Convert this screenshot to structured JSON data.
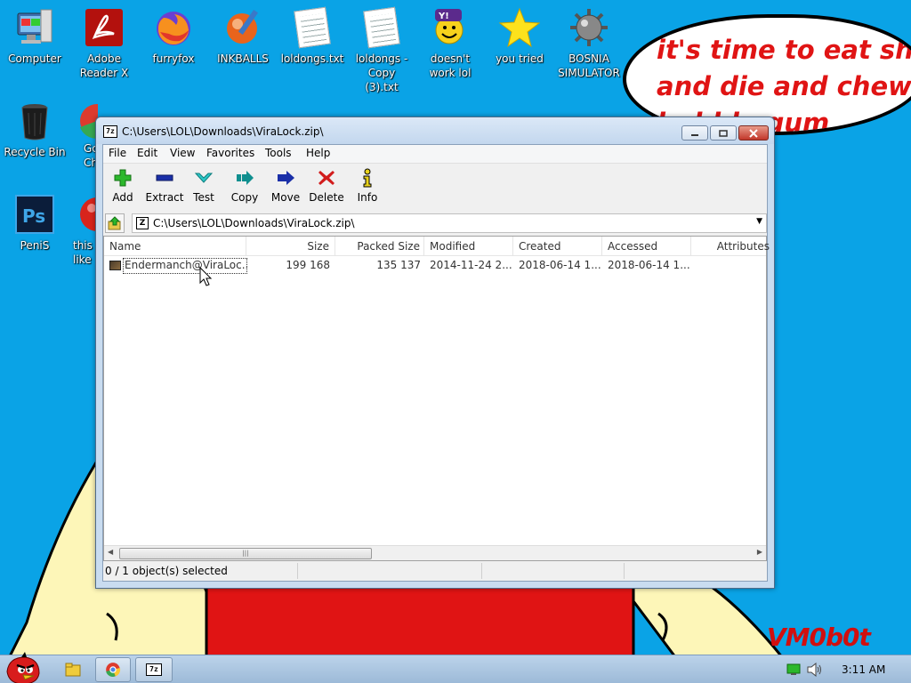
{
  "desktop": {
    "icons": [
      {
        "label": "Computer",
        "icon": "computer-icon"
      },
      {
        "label": "Adobe Reader X",
        "icon": "adobe-reader-icon"
      },
      {
        "label": "furryfox",
        "icon": "firefox-icon"
      },
      {
        "label": "INKBALLS",
        "icon": "inkball-icon"
      },
      {
        "label": "loldongs.txt",
        "icon": "text-file-icon"
      },
      {
        "label": "loldongs - Copy (3).txt",
        "icon": "text-file-icon"
      },
      {
        "label": "doesn't work lol",
        "icon": "yahoo-messenger-icon"
      },
      {
        "label": "you tried",
        "icon": "star-icon"
      },
      {
        "label": "BOSNIA SIMULATOR",
        "icon": "mine-icon"
      },
      {
        "label": "Recycle Bin",
        "icon": "recycle-bin-icon"
      },
      {
        "label": "Gc Ch",
        "icon": "chrome-icon"
      },
      {
        "label": "PeniS",
        "icon": "photoshop-icon"
      },
      {
        "label": "this like",
        "icon": "red-ball-icon"
      }
    ],
    "speech_bubble": "it's time to eat shit\nand die and chew\nbubble gum",
    "watermark": "VM0b0t",
    "colors": {
      "background": "#0aa3e6",
      "accent_red": "#e01414"
    }
  },
  "window": {
    "title": "C:\\Users\\LOL\\Downloads\\ViraLock.zip\\",
    "menu": [
      "File",
      "Edit",
      "View",
      "Favorites",
      "Tools",
      "Help"
    ],
    "toolbar": [
      {
        "label": "Add",
        "icon": "plus-icon"
      },
      {
        "label": "Extract",
        "icon": "minus-icon"
      },
      {
        "label": "Test",
        "icon": "check-icon"
      },
      {
        "label": "Copy",
        "icon": "double-arrow-icon"
      },
      {
        "label": "Move",
        "icon": "arrow-right-icon"
      },
      {
        "label": "Delete",
        "icon": "x-icon"
      },
      {
        "label": "Info",
        "icon": "info-icon"
      }
    ],
    "address": "C:\\Users\\LOL\\Downloads\\ViraLock.zip\\",
    "columns": [
      "Name",
      "Size",
      "Packed Size",
      "Modified",
      "Created",
      "Accessed",
      "Attributes"
    ],
    "rows": [
      {
        "name": "Endermanch@ViraLoc...",
        "size": "199 168",
        "packed": "135 137",
        "modified": "2014-11-24 2...",
        "created": "2018-06-14 1...",
        "accessed": "2018-06-14 1..."
      }
    ],
    "status": "0 / 1 object(s) selected",
    "scrollbar_grip": "|||"
  },
  "taskbar": {
    "clock": "3:11 AM",
    "items": [
      "explorer",
      "chrome",
      "7z"
    ]
  }
}
